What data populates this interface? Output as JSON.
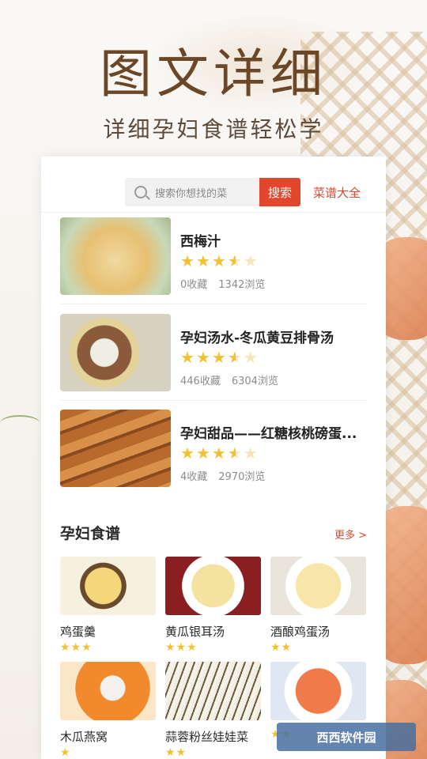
{
  "hero": {
    "title": "图文详细",
    "subtitle": "详细孕妇食谱轻松学"
  },
  "search": {
    "placeholder": "搜索你想找的菜",
    "button_label": "搜索",
    "all_recipes_label": "菜谱大全"
  },
  "recipes": [
    {
      "name": "西梅汁",
      "rating": 3.5,
      "favorites": "0收藏",
      "views": "1342浏览",
      "thumb": "food-juice"
    },
    {
      "name": "孕妇汤水-冬瓜黄豆排骨汤",
      "rating": 3.5,
      "favorites": "446收藏",
      "views": "6304浏览",
      "thumb": "food-soup"
    },
    {
      "name": "孕妇甜品——红糖核桃磅蛋...",
      "rating": 3.5,
      "favorites": "4收藏",
      "views": "2970浏览",
      "thumb": "food-cake"
    }
  ],
  "section": {
    "title": "孕妇食谱",
    "more_label": "更多 >"
  },
  "grid": [
    {
      "name": "鸡蛋羹",
      "stars": "★★★",
      "thumb": "food-egg"
    },
    {
      "name": "黄瓜银耳汤",
      "stars": "★★★",
      "thumb": "food-cucumber"
    },
    {
      "name": "酒酿鸡蛋汤",
      "stars": "★★",
      "thumb": "food-rice"
    },
    {
      "name": "木瓜燕窝",
      "stars": "★",
      "thumb": "food-papaya"
    },
    {
      "name": "蒜蓉粉丝娃娃菜",
      "stars": "★★",
      "thumb": "food-cabbage"
    },
    {
      "name": "",
      "stars": "★★",
      "thumb": "food-shrimp"
    }
  ],
  "watermark": {
    "text": "西西软件园"
  },
  "colors": {
    "accent": "#e2462c",
    "star": "#f3c130",
    "brand_text": "#6b4728"
  }
}
